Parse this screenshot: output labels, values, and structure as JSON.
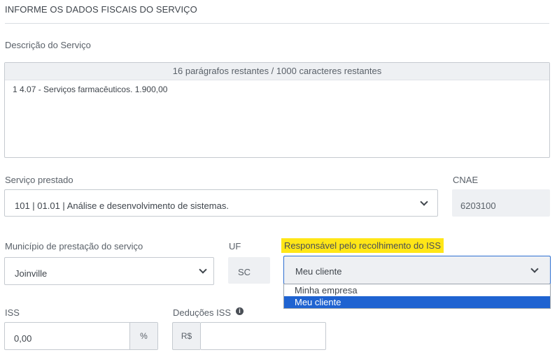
{
  "section": {
    "title": "INFORME OS DADOS FISCAIS DO SERVIÇO"
  },
  "descricao": {
    "label": "Descrição do Serviço",
    "counter": "16 parágrafos restantes / 1000 caracteres restantes",
    "value": "1 4.07 - Serviços farmacêuticos. 1.900,00"
  },
  "servico": {
    "label": "Serviço prestado",
    "value": "101 | 01.01 | Análise e desenvolvimento de sistemas."
  },
  "cnae": {
    "label": "CNAE",
    "value": "6203100"
  },
  "municipio": {
    "label": "Município de prestação do serviço",
    "value": "Joinville"
  },
  "uf": {
    "label": "UF",
    "value": "SC"
  },
  "responsavel": {
    "label": "Responsável pelo recolhimento do ISS",
    "value": "Meu cliente",
    "options": [
      "Minha empresa",
      "Meu cliente"
    ],
    "selected_index": 1
  },
  "iss": {
    "label": "ISS",
    "value": "0,00",
    "suffix": "%"
  },
  "deducoes": {
    "label": "Deduções ISS",
    "prefix": "R$",
    "value": "",
    "info_icon": "info-circle-icon"
  },
  "colors": {
    "highlight": "#ffe617",
    "focus": "#2e6fd1",
    "selected": "#1f63d1"
  }
}
